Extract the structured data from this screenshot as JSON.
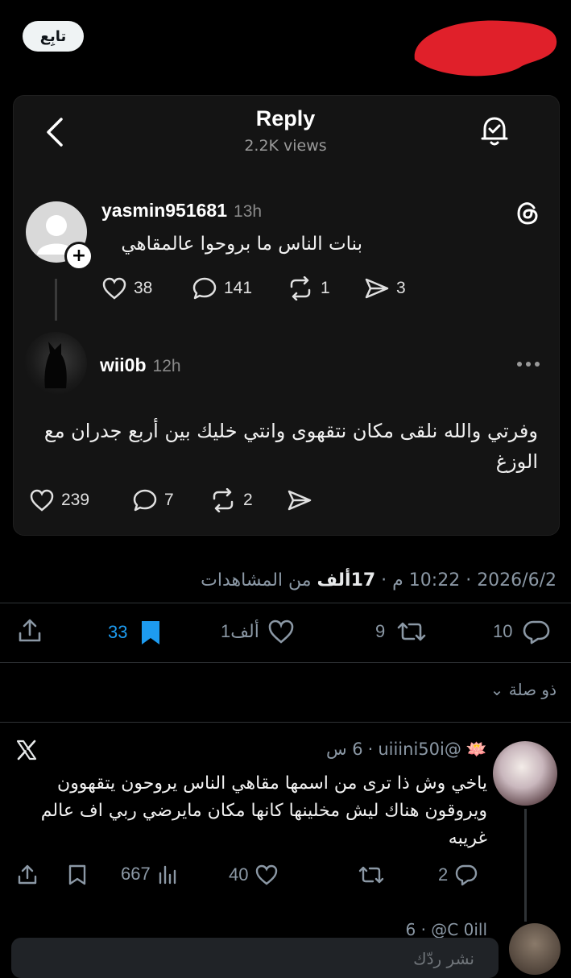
{
  "top": {
    "follow_label": "تابِع",
    "redact_color": "#e0202a"
  },
  "embed": {
    "title": "Reply",
    "views": "2.2K views",
    "post1": {
      "username": "yasmin951681",
      "time": "13h",
      "text": "بنات الناس ما بروحوا عالمقاهي",
      "likes": "38",
      "comments": "141",
      "reposts": "1",
      "shares": "3"
    },
    "post2": {
      "username": "wii0b",
      "time": "12h",
      "text": "وفرتي والله نلقى مكان نتقهوى وانتي خليك بين أربع جدران مع الوزغ",
      "likes": "239",
      "comments": "7",
      "reposts": "2"
    }
  },
  "tweet_meta": {
    "date": "2026/6/2",
    "time": "10:22 م",
    "views_count": "17ألف",
    "views_label": "من المشاهدات"
  },
  "actions": {
    "replies": "10",
    "reposts": "9",
    "likes": "1ألف",
    "bookmarks": "33"
  },
  "related_label": "ذو صلة",
  "reply": {
    "emoji": "🪷",
    "handle": "@uiiini50i",
    "time": "6 س",
    "text": "ياخي وش ذا ترى من اسمها مقاهي الناس يروحون يتقهوون ويروقون هناك ليش مخلينها كانها مكان مايرضي ربي اف عالم غريبه",
    "replies": "2",
    "likes": "40",
    "views": "667"
  },
  "next_peek": "6 · @C 0ill",
  "compose_placeholder": "نشر ردّك",
  "colors": {
    "accent": "#1d9bf0",
    "muted": "#8b98a5",
    "background": "#000000"
  }
}
